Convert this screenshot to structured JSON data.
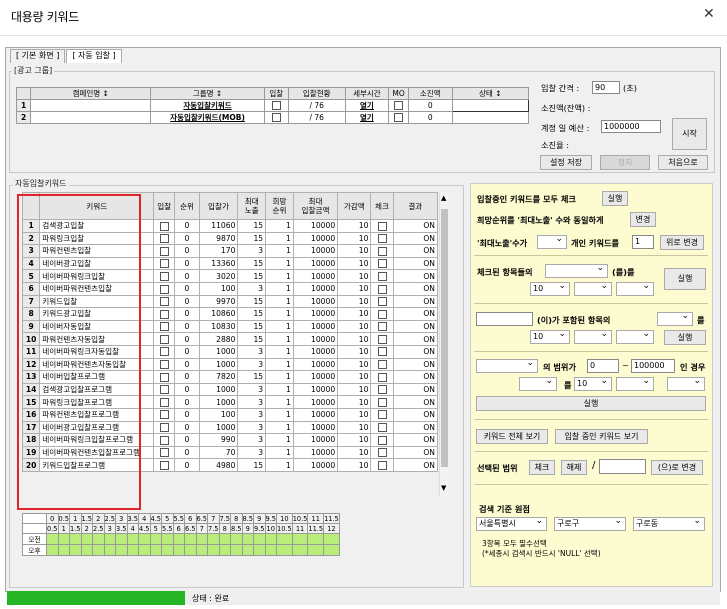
{
  "window": {
    "title": "대용량 키워드",
    "close_glyph": "✕"
  },
  "tabs": [
    "[ 기본 화면 ]",
    "[ 자동 입찰 ]"
  ],
  "ad_group": {
    "label": "[광고 그룹]",
    "headers": [
      "캠페인명 ↕",
      "그룹명 ↕",
      "입찰",
      "입찰현황",
      "세부시간",
      "MO",
      "소진액",
      "상태 ↕"
    ],
    "rows": [
      {
        "num": "1",
        "group": "자동입찰키워드",
        "status": "/ 76",
        "detail": "열기",
        "spent": "0"
      },
      {
        "num": "2",
        "group": "자동입찰키워드(MOB)",
        "status": "/ 76",
        "detail": "열기",
        "spent": "0"
      }
    ]
  },
  "controls": {
    "interval_label": "입찰 간격 :",
    "interval_value": "90",
    "interval_unit": "(초)",
    "spent_label": "소진액(잔액) :",
    "budget_label": "계정 일 예산 :",
    "budget_value": "1000000",
    "consumed_label": "소진율 :",
    "start": "시작",
    "save": "설정 저장",
    "stop": "정지",
    "first": "처음으로"
  },
  "keywords": {
    "label": "자동입찰키워드",
    "headers": [
      "키워드",
      "입찰",
      "순위",
      "입찰가",
      "최대\n노출",
      "희망\n순위",
      "최대\n입찰금액",
      "가감액",
      "체크",
      "결과"
    ],
    "rows": [
      [
        "1",
        "검색광고입찰",
        "0",
        "11060",
        "15",
        "1",
        "10000",
        "10",
        "ON"
      ],
      [
        "2",
        "파워링크입찰",
        "0",
        "9870",
        "15",
        "1",
        "10000",
        "10",
        "ON"
      ],
      [
        "3",
        "파워컨텐츠입찰",
        "0",
        "170",
        "3",
        "1",
        "10000",
        "10",
        "ON"
      ],
      [
        "4",
        "네이버광고입찰",
        "0",
        "13360",
        "15",
        "1",
        "10000",
        "10",
        "ON"
      ],
      [
        "5",
        "네이버파워링크입찰",
        "0",
        "3020",
        "15",
        "1",
        "10000",
        "10",
        "ON"
      ],
      [
        "6",
        "네이버파워컨텐츠입찰",
        "0",
        "100",
        "3",
        "1",
        "10000",
        "10",
        "ON"
      ],
      [
        "7",
        "키워드입찰",
        "0",
        "9970",
        "15",
        "1",
        "10000",
        "10",
        "ON"
      ],
      [
        "8",
        "키워드광고입찰",
        "0",
        "10860",
        "15",
        "1",
        "10000",
        "10",
        "ON"
      ],
      [
        "9",
        "네이버자동입찰",
        "0",
        "10830",
        "15",
        "1",
        "10000",
        "10",
        "ON"
      ],
      [
        "10",
        "파워컨텐츠자동입찰",
        "0",
        "2880",
        "15",
        "1",
        "10000",
        "10",
        "ON"
      ],
      [
        "11",
        "네이버파워링크자동입찰",
        "0",
        "1000",
        "3",
        "1",
        "10000",
        "10",
        "ON"
      ],
      [
        "12",
        "네이버파워컨텐츠자동입찰",
        "0",
        "1000",
        "3",
        "1",
        "10000",
        "10",
        "ON"
      ],
      [
        "13",
        "네이버입찰프로그램",
        "0",
        "7820",
        "15",
        "1",
        "10000",
        "10",
        "ON"
      ],
      [
        "14",
        "검색광고입찰프로그램",
        "0",
        "1000",
        "3",
        "1",
        "10000",
        "10",
        "ON"
      ],
      [
        "15",
        "파워링크입찰프로그램",
        "0",
        "1000",
        "3",
        "1",
        "10000",
        "10",
        "ON"
      ],
      [
        "16",
        "파워컨텐츠입찰프로그램",
        "0",
        "100",
        "3",
        "1",
        "10000",
        "10",
        "ON"
      ],
      [
        "17",
        "네이버광고입찰프로그램",
        "0",
        "1000",
        "3",
        "1",
        "10000",
        "10",
        "ON"
      ],
      [
        "18",
        "네이버파워링크입찰프로그램",
        "0",
        "990",
        "3",
        "1",
        "10000",
        "10",
        "ON"
      ],
      [
        "19",
        "네이버파워컨텐츠입찰프로그램",
        "0",
        "70",
        "3",
        "1",
        "10000",
        "10",
        "ON"
      ],
      [
        "20",
        "키워드입찰프로그램",
        "0",
        "4980",
        "15",
        "1",
        "10000",
        "10",
        "ON"
      ]
    ]
  },
  "schedule": {
    "top": [
      "0",
      "0.5",
      "1",
      "1.5",
      "2",
      "2.5",
      "3",
      "3.5",
      "4",
      "4.5",
      "5",
      "5.5",
      "6",
      "6.5",
      "7",
      "7.5",
      "8",
      "8.5",
      "9",
      "9.5",
      "10",
      "10.5",
      "11",
      "11.5"
    ],
    "bottom": [
      "0.5",
      "1",
      "1.5",
      "2",
      "2.5",
      "3",
      "3.5",
      "4",
      "4.5",
      "5",
      "5.5",
      "6",
      "6.5",
      "7",
      "7.5",
      "8",
      "8.5",
      "9",
      "9.5",
      "10",
      "10.5",
      "11",
      "11.5",
      "12"
    ],
    "rows": [
      "오전",
      "오후"
    ]
  },
  "panel": {
    "check_all": "입찰중인 키워드를 모두 체크",
    "run": "실행",
    "match_rank": "희망순위를 '최대노출' 수와 동일하게",
    "change": "변경",
    "max_exp_label": "'최대노출'수가",
    "personal": "개인 키워드를",
    "personal_value": "1",
    "up_change": "위로 변경",
    "checked_items": "체크된 항목들의",
    "as": "(를)를",
    "ten": "10",
    "contains": "(이)가 포함된 항목의",
    "eul": "를",
    "range_label": "의 범위가",
    "range_from": "0",
    "tilde": "~",
    "range_to": "100000",
    "in_case": "인 경우",
    "to": "를",
    "view_all": "키워드 전체 보기",
    "view_bidding": "입찰 중인 키워드 보기",
    "range": "선택된 범위",
    "check": "체크",
    "uncheck": "해제",
    "slash": "/",
    "to_change": "(으)로 변경",
    "search_base": "검색 기준 원점",
    "city": "서울특별시",
    "district": "구로구",
    "dong": "구로동",
    "note1": "3항목 모두 필수선택",
    "note2": "(*세종시 검색시 반드시 'NULL' 선택)"
  },
  "status_bar": {
    "text": "상태 : 완료",
    "progress": 0.25
  },
  "highlight_color": "#e0242b"
}
